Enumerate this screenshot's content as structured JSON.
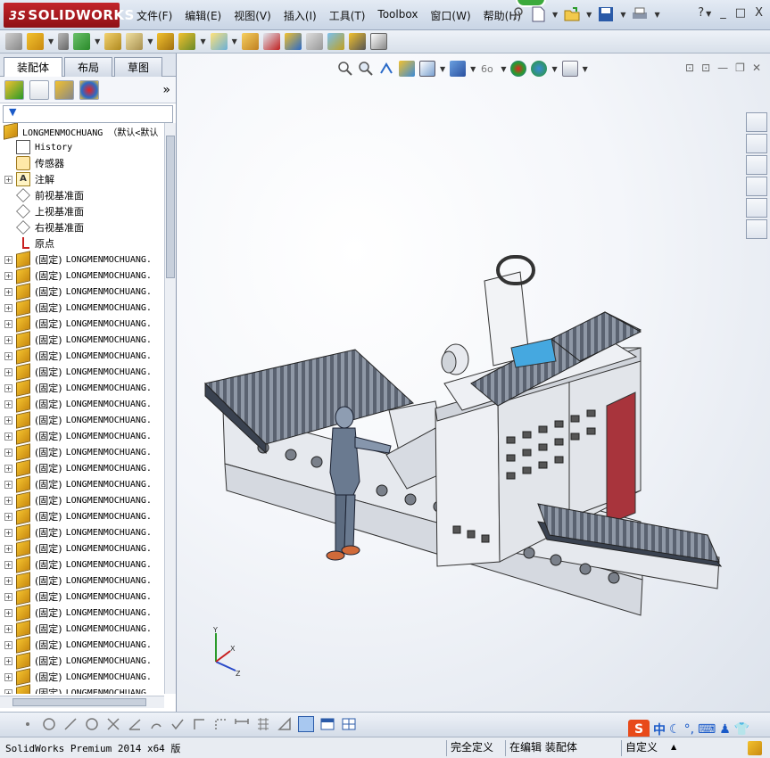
{
  "app": {
    "logo_prefix": "3S",
    "logo_text": "SOLIDWORKS"
  },
  "menu": [
    "文件(F)",
    "编辑(E)",
    "视图(V)",
    "插入(I)",
    "工具(T)",
    "Toolbox",
    "窗口(W)",
    "帮助(H)"
  ],
  "window_controls": [
    "?",
    "_",
    "□",
    "X"
  ],
  "panel": {
    "tabs": [
      "装配体",
      "布局",
      "草图"
    ],
    "expand_glyph": "»",
    "filter_glyph": "▼"
  },
  "tree": {
    "root": "LONGMENMOCHUANG （默认<默认",
    "items": [
      {
        "label": "History",
        "icon": "history-icon",
        "expandable": false,
        "mono": true
      },
      {
        "label": "传感器",
        "icon": "sensor-icon",
        "expandable": false
      },
      {
        "label": "注解",
        "icon": "annotation-icon",
        "expandable": true
      },
      {
        "label": "前视基准面",
        "icon": "plane-icon",
        "expandable": false
      },
      {
        "label": "上视基准面",
        "icon": "plane-icon",
        "expandable": false
      },
      {
        "label": "右视基准面",
        "icon": "plane-icon",
        "expandable": false
      },
      {
        "label": "原点",
        "icon": "origin-icon",
        "expandable": false
      }
    ],
    "component_prefix": "(固定)",
    "component_name": "LONGMENMOCHUANG.",
    "component_count": 28
  },
  "status": {
    "product": "SolidWorks Premium 2014 x64 版",
    "state": "完全定义",
    "mode": "在编辑 装配体",
    "units": "自定义"
  },
  "ime": {
    "lang": "中"
  },
  "colors": {
    "accent": "#c3252b",
    "machine_body": "#e8eaef",
    "machine_red": "#a8343c",
    "highlight": "#45a8e0"
  }
}
